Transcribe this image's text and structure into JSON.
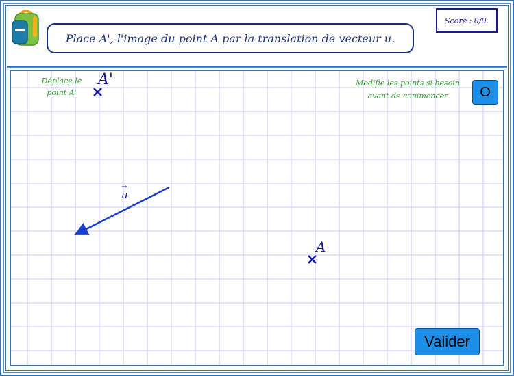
{
  "instruction": "Place A', l'image du point A par la translation de vecteur u.",
  "score": "Score : 0/0.",
  "hints": {
    "left_line1": "Déplace le",
    "left_line2": "point A'",
    "right_line1": "Modifie les points si besoin",
    "right_line2": "avant de commencer"
  },
  "buttons": {
    "reset_label": "O",
    "validate_label": "Valider"
  },
  "points": {
    "a_prime_label": "A'",
    "a_label": "A"
  },
  "vector": {
    "label": "u"
  },
  "colors": {
    "grid": "#c9c9f5",
    "point": "#1a1aa0",
    "vector": "#1a3fd0",
    "hint": "#2fa52f",
    "button": "#1e8fe6",
    "frame": "#3a6fa8"
  },
  "icons": {
    "logo": "school-backpack-icon",
    "point_marker": "cross-marker-icon"
  }
}
